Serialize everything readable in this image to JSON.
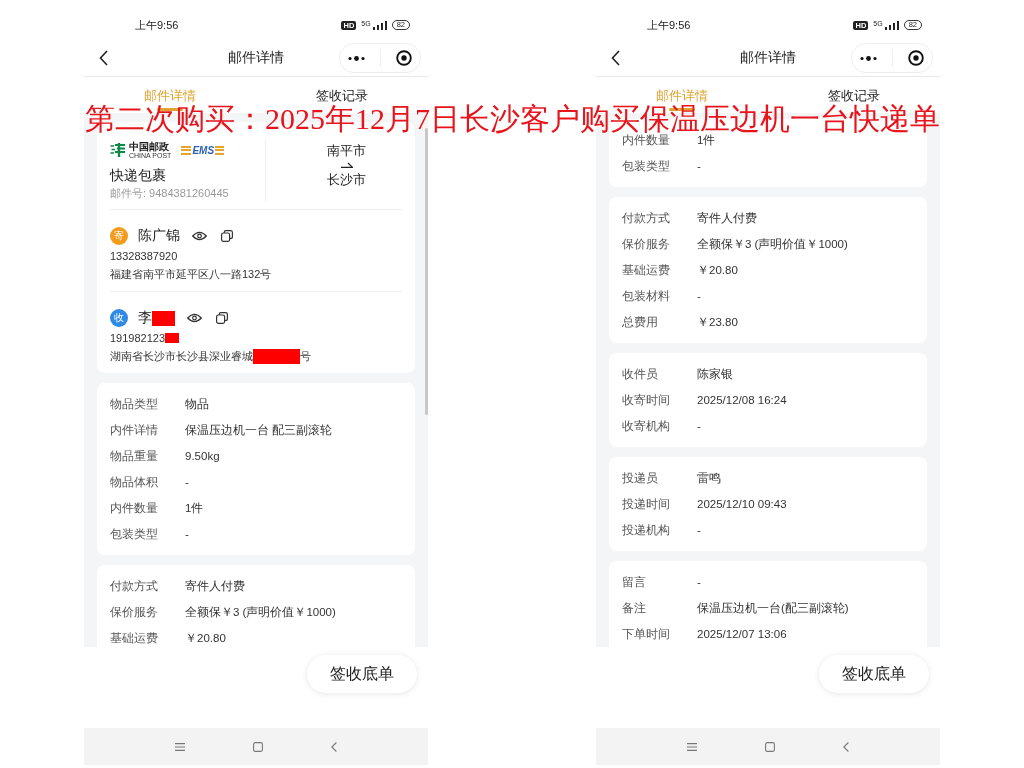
{
  "annotation": "第二次购买：2025年12月7日长沙客户购买保温压边机一台快递单",
  "screens": [
    {
      "status_bar": {
        "time": "上午9:56",
        "network_badge": "HD",
        "network": "5G",
        "battery": "82"
      },
      "title_bar": {
        "title": "邮件详情"
      },
      "tabs": [
        {
          "label": "邮件详情",
          "selected": true
        },
        {
          "label": "签收记录",
          "selected": false
        }
      ],
      "scrollbar_visible": true,
      "shipment": {
        "carrier_logo": {
          "name_cn": "中国邮政",
          "name_en": "CHINA POST",
          "service": "EMS"
        },
        "parcel_type": "快递包裹",
        "tracking_number": "邮件号: 9484381260445",
        "origin": "南平市",
        "destination": "长沙市",
        "contacts": [
          {
            "badge": "寄",
            "color": "#f29b1d",
            "name": [
              {
                "kind": "text",
                "text": "陈广锦"
              }
            ],
            "phone": [
              {
                "kind": "text",
                "text": "13328387920"
              }
            ],
            "address": [
              {
                "kind": "text",
                "text": "福建省南平市延平区八一路132号"
              }
            ]
          },
          {
            "badge": "收",
            "color": "#2f8ae5",
            "name": [
              {
                "kind": "text",
                "text": "李"
              },
              {
                "kind": "redaction"
              }
            ],
            "phone": [
              {
                "kind": "text",
                "text": "191982123"
              },
              {
                "kind": "redaction"
              }
            ],
            "address": [
              {
                "kind": "text",
                "text": "湖南省长沙市长沙县深业睿城"
              },
              {
                "kind": "redaction"
              },
              {
                "kind": "text",
                "text": "号"
              }
            ]
          }
        ]
      },
      "detail_cards": [
        {
          "rows": [
            {
              "label": "物品类型",
              "value": "物品"
            },
            {
              "label": "内件详情",
              "value": "保温压边机一台 配三副滚轮"
            },
            {
              "label": "物品重量",
              "value": "9.50kg"
            },
            {
              "label": "物品体积",
              "value": "-"
            },
            {
              "label": "内件数量",
              "value": "1件"
            },
            {
              "label": "包装类型",
              "value": "-"
            }
          ]
        },
        {
          "rows": [
            {
              "label": "付款方式",
              "value": "寄件人付费"
            },
            {
              "label": "保价服务",
              "value": "全额保￥3 (声明价值￥1000)"
            },
            {
              "label": "基础运费",
              "value": "￥20.80"
            }
          ]
        }
      ],
      "bottom_button": "签收底单"
    },
    {
      "status_bar": {
        "time": "上午9:56",
        "network_badge": "HD",
        "network": "5G",
        "battery": "82"
      },
      "title_bar": {
        "title": "邮件详情"
      },
      "tabs": [
        {
          "label": "邮件详情",
          "selected": true
        },
        {
          "label": "签收记录",
          "selected": false
        }
      ],
      "scrollbar_visible": false,
      "detail_cards": [
        {
          "rows": [
            {
              "label": "内件数量",
              "value": "1件"
            },
            {
              "label": "包装类型",
              "value": "-"
            }
          ]
        },
        {
          "rows": [
            {
              "label": "付款方式",
              "value": "寄件人付费"
            },
            {
              "label": "保价服务",
              "value": "全额保￥3 (声明价值￥1000)"
            },
            {
              "label": "基础运费",
              "value": "￥20.80"
            },
            {
              "label": "包装材料",
              "value": "-"
            },
            {
              "label": "总费用",
              "value": "￥23.80"
            }
          ]
        },
        {
          "rows": [
            {
              "label": "收件员",
              "value": "陈家银"
            },
            {
              "label": "收寄时间",
              "value": "2025/12/08 16:24"
            },
            {
              "label": "收寄机构",
              "value": "-"
            }
          ]
        },
        {
          "rows": [
            {
              "label": "投递员",
              "value": "雷鸣"
            },
            {
              "label": "投递时间",
              "value": "2025/12/10 09:43"
            },
            {
              "label": "投递机构",
              "value": "-"
            }
          ]
        },
        {
          "rows": [
            {
              "label": "留言",
              "value": "-"
            },
            {
              "label": "备注",
              "value": "保温压边机一台(配三副滚轮)"
            },
            {
              "label": "下单时间",
              "value": "2025/12/07 13:06"
            }
          ]
        }
      ],
      "bottom_button": "签收底单"
    }
  ]
}
